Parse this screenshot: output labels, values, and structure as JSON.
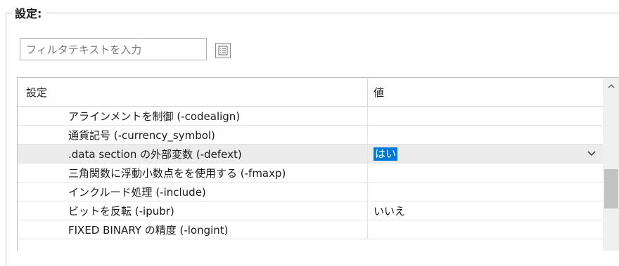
{
  "group": {
    "title": "設定:"
  },
  "filter": {
    "placeholder": "フィルタテキストを入力"
  },
  "grid": {
    "columns": {
      "setting": "設定",
      "value": "値"
    },
    "rows": [
      {
        "name": "アラインメントを制御 (-codealign)",
        "value": ""
      },
      {
        "name": "通貨記号 (-currency_symbol)",
        "value": ""
      },
      {
        "name": ".data section の外部変数 (-defext)",
        "value": "はい",
        "selected": true
      },
      {
        "name": "三角関数に浮動小数点をを使用する (-fmaxp)",
        "value": ""
      },
      {
        "name": "インクルード処理 (-include)",
        "value": ""
      },
      {
        "name": "ビットを反転 (-ipubr)",
        "value": "いいえ"
      },
      {
        "name": "FIXED BINARY の精度 (-longint)",
        "value": ""
      }
    ]
  },
  "colors": {
    "selection": "#0078d7",
    "selected_row": "#ececec"
  },
  "icons": {
    "filter_options": "list-filter-icon",
    "dropdown": "chevron-down-icon",
    "scroll_up": "chevron-up-icon"
  }
}
